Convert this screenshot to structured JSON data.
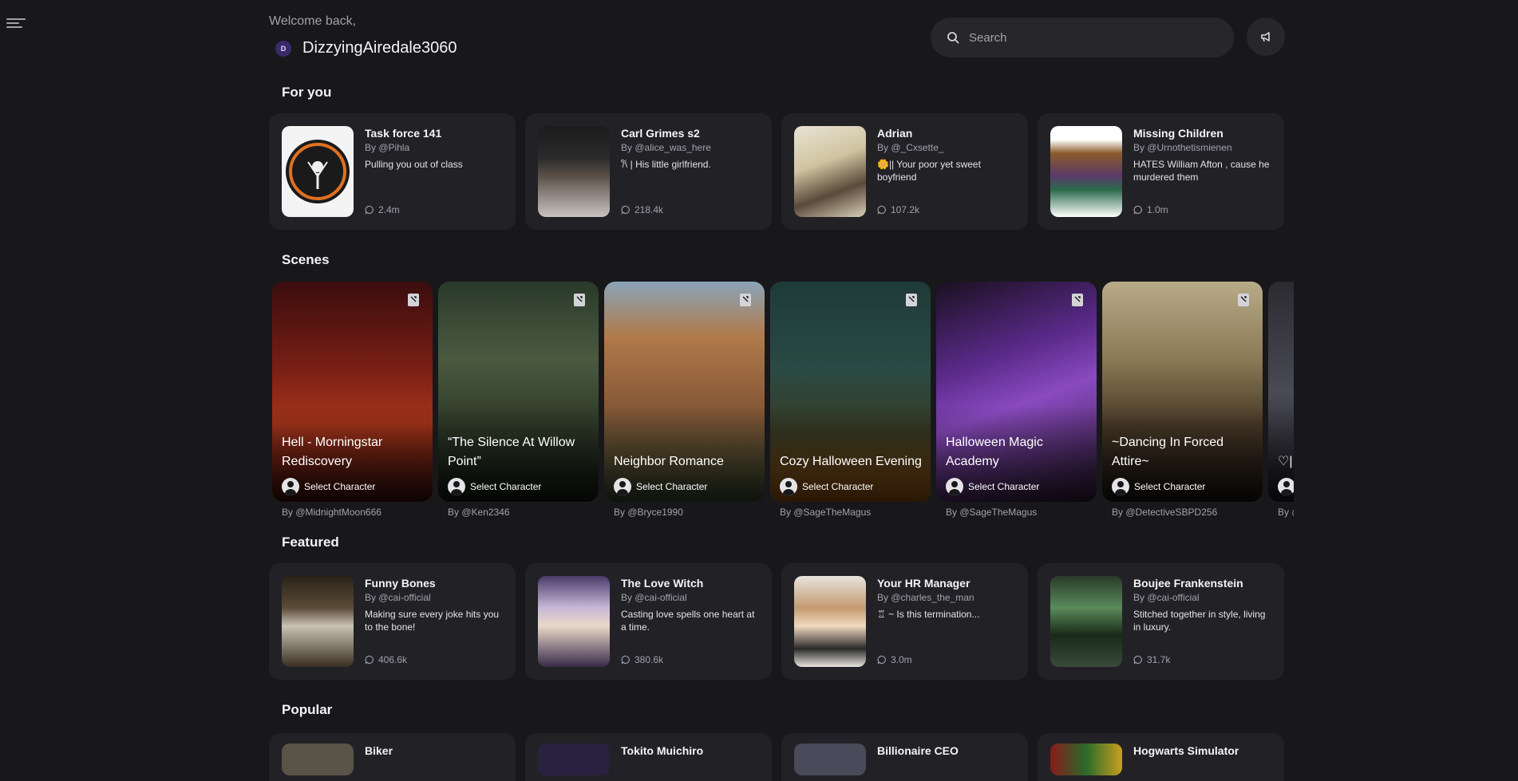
{
  "header": {
    "welcome": "Welcome back,",
    "avatar_initial": "D",
    "username": "DizzyingAiredale3060",
    "search_placeholder": "Search"
  },
  "sections": {
    "for_you": "For you",
    "scenes": "Scenes",
    "featured": "Featured",
    "popular": "Popular"
  },
  "for_you": [
    {
      "name": "Task force 141",
      "author": "By @Pihla",
      "desc": "Pulling you out of class",
      "stats": "2.4m"
    },
    {
      "name": "Carl Grimes s2",
      "author": "By @alice_was_here",
      "desc": "𐙚 | His little girlfriend.",
      "stats": "218.4k"
    },
    {
      "name": "Adrian",
      "author": "By @_Cxsette_",
      "desc": "🌼|| Your poor yet sweet boyfriend",
      "stats": "107.2k"
    },
    {
      "name": "Missing Children",
      "author": "By @Urnothetismienen",
      "desc": "HATES William Afton , cause he murdered them",
      "stats": "1.0m"
    }
  ],
  "scenes": [
    {
      "title": "Hell - Morningstar Rediscovery",
      "select": "Select Character",
      "author": "By @MidnightMoon666"
    },
    {
      "title": "“The Silence At Willow Point”",
      "select": "Select Character",
      "author": "By @Ken2346"
    },
    {
      "title": "Neighbor Romance",
      "select": "Select Character",
      "author": "By @Bryce1990"
    },
    {
      "title": "Cozy Halloween Evening",
      "select": "Select Character",
      "author": "By @SageTheMagus"
    },
    {
      "title": "Halloween Magic Academy",
      "select": "Select Character",
      "author": "By @SageTheMagus"
    },
    {
      "title": "~Dancing In Forced Attire~",
      "select": "Select Character",
      "author": "By @DetectiveSBPD256"
    },
    {
      "title": "♡|",
      "select": "",
      "author": "By @"
    }
  ],
  "featured": [
    {
      "name": "Funny Bones",
      "author": "By @cai-official",
      "desc": "Making sure every joke hits you to the bone!",
      "stats": "406.6k"
    },
    {
      "name": "The Love Witch",
      "author": "By @cai-official",
      "desc": "Casting love spells one heart at a time.",
      "stats": "380.6k"
    },
    {
      "name": "Your HR Manager",
      "author": "By @charles_the_man",
      "desc": "♖ ~ Is this termination...",
      "stats": "3.0m"
    },
    {
      "name": "Boujee Frankenstein",
      "author": "By @cai-official",
      "desc": "Stitched together in style, living in luxury.",
      "stats": "31.7k"
    }
  ],
  "popular": [
    {
      "name": "Biker"
    },
    {
      "name": "Tokito Muichiro"
    },
    {
      "name": "Billionaire CEO"
    },
    {
      "name": "Hogwarts Simulator"
    }
  ],
  "colors": {
    "background": "#18181b",
    "card": "#222226",
    "muted": "#a1a1aa"
  },
  "icons": {
    "menu": "hamburger-icon",
    "search": "search-icon",
    "announce": "megaphone-icon",
    "chat": "chat-bubble-icon",
    "bookmark": "book-icon"
  }
}
